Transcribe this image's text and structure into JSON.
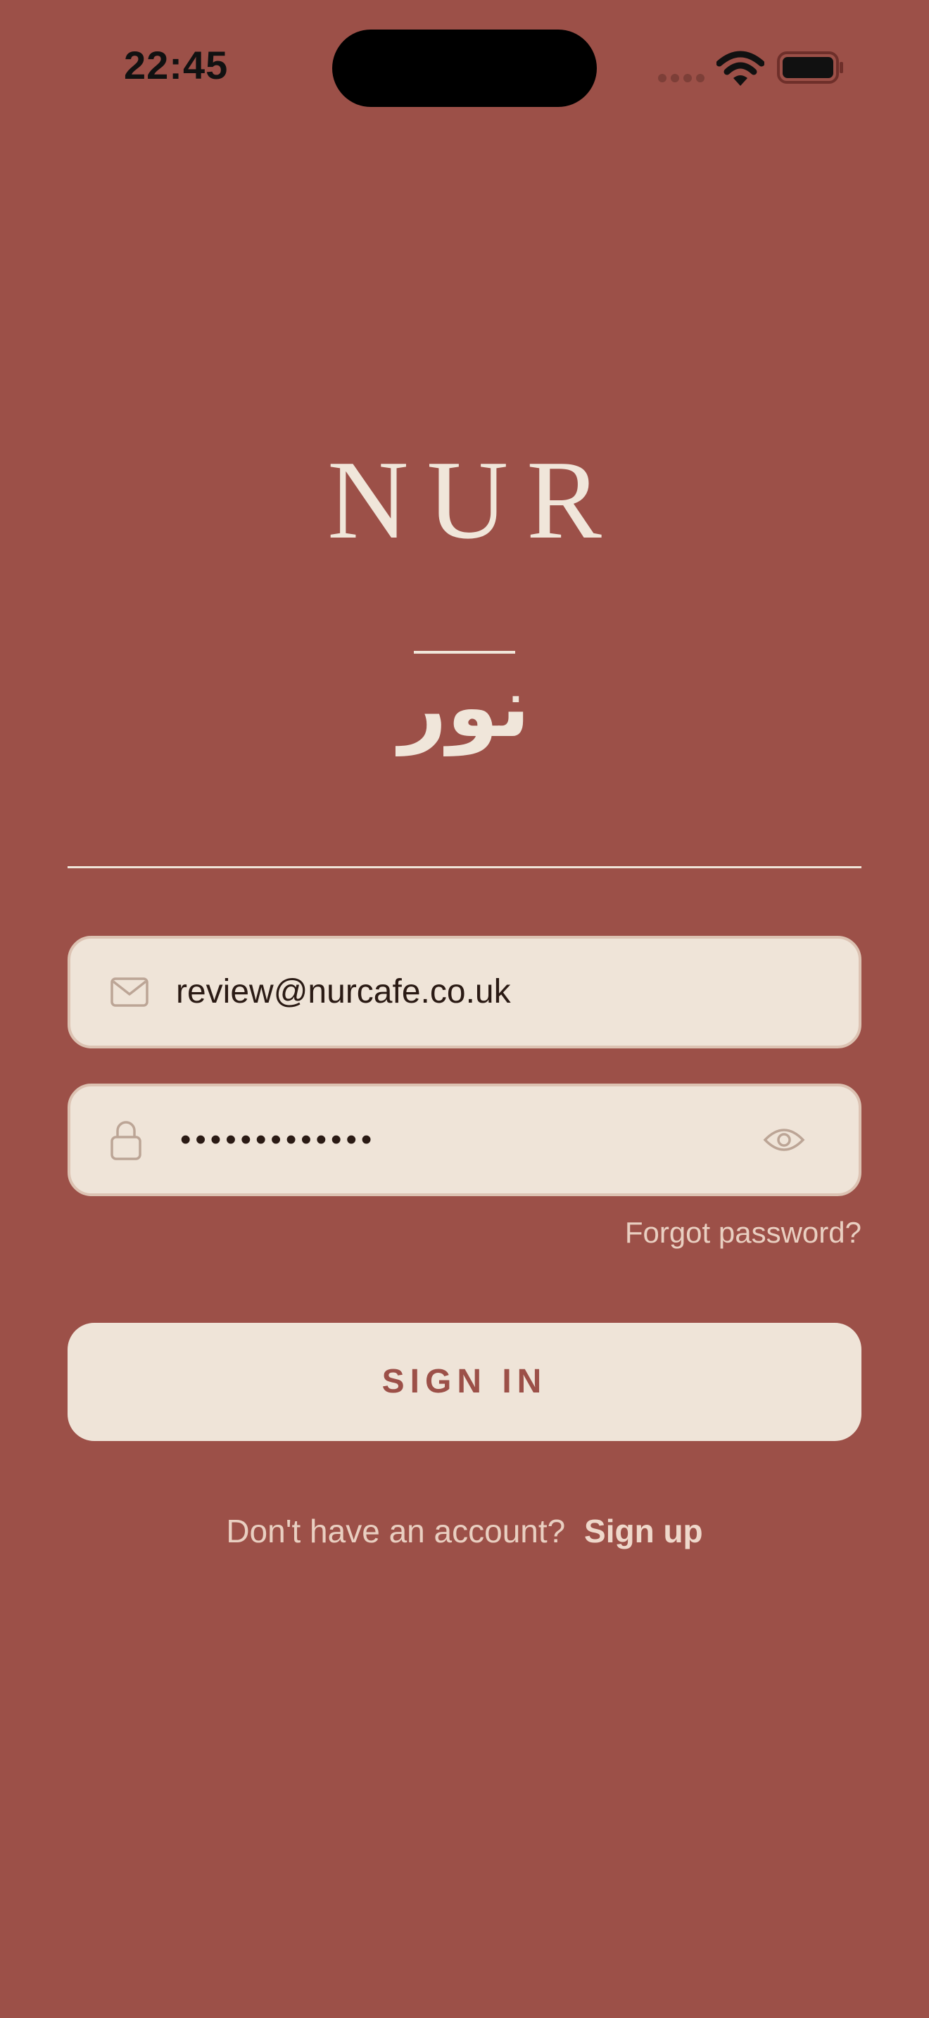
{
  "status_bar": {
    "time": "22:45",
    "icons": [
      "cellular-signal-icon",
      "wifi-icon",
      "battery-icon"
    ]
  },
  "brand": {
    "wordmark": "NUR",
    "arabic": "نور"
  },
  "email_field": {
    "icon": "envelope-icon",
    "value": "review@nurcafe.co.uk"
  },
  "password_field": {
    "icon": "lock-icon",
    "value_masked": "•••••••••••••",
    "toggle_icon": "eye-icon"
  },
  "forgot_password": "Forgot password?",
  "sign_in_label": "SIGN IN",
  "signup": {
    "prompt": "Don't have an account?",
    "link": "Sign up"
  },
  "colors": {
    "background": "#9c5048",
    "cream": "#efe4d8",
    "field_border": "#dcc2b2",
    "muted_text": "#e9cfc1",
    "accent_text": "#9c5048"
  }
}
